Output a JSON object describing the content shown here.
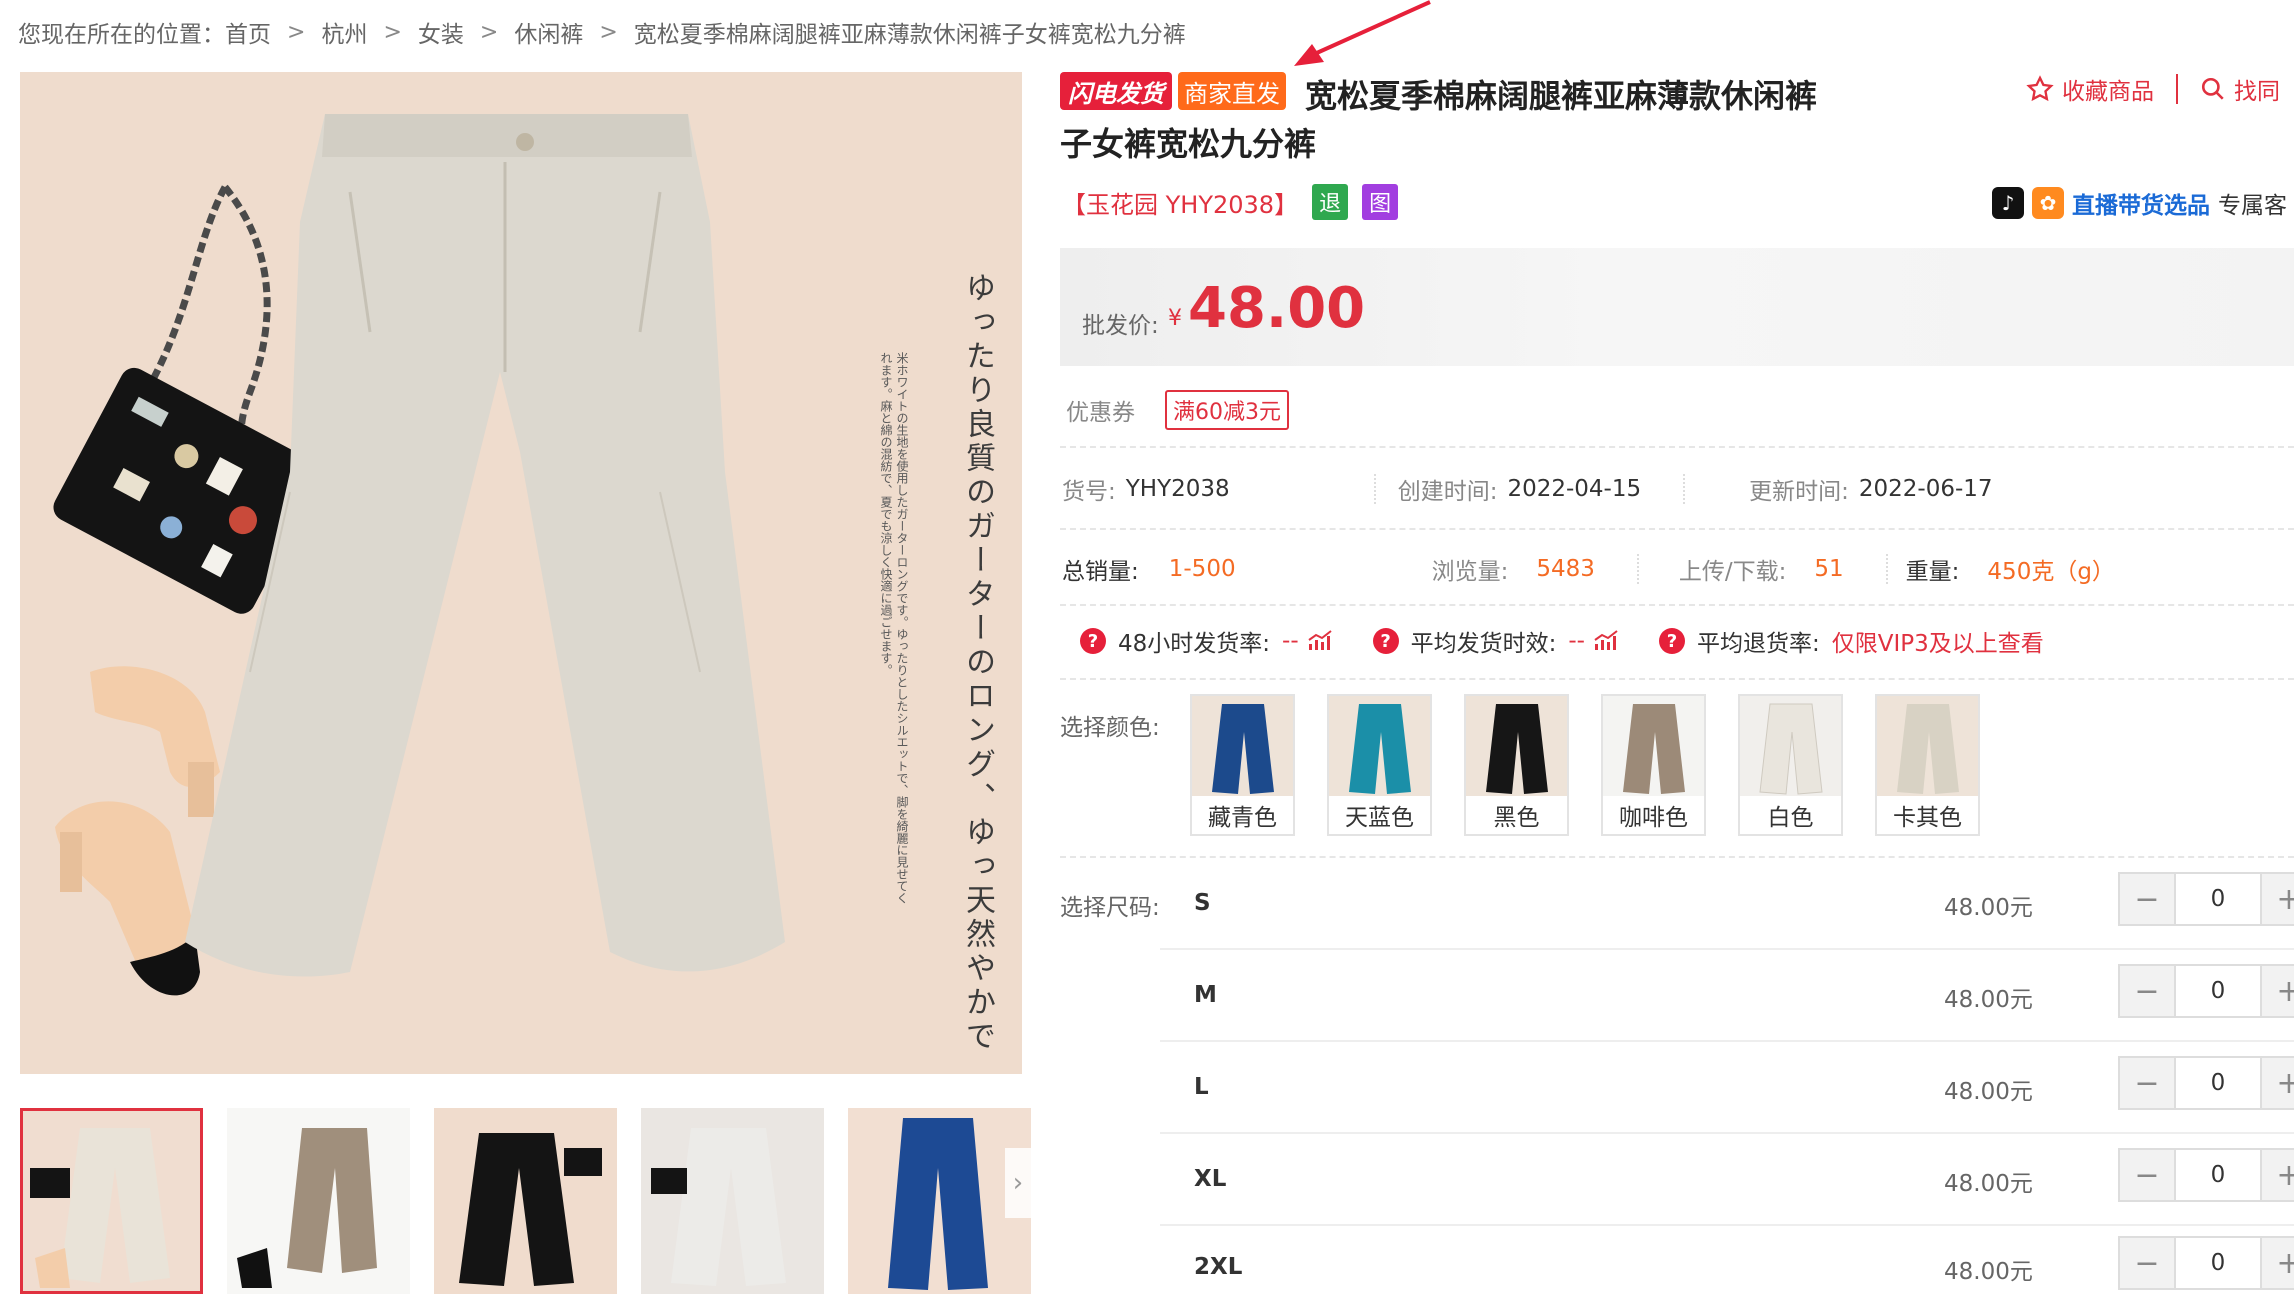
{
  "breadcrumb": {
    "prefix": "您现在所在的位置：",
    "items": [
      "首页",
      "杭州",
      "女装",
      "休闲裤",
      "宽松夏季棉麻阔腿裤亚麻薄款休闲裤子女裤宽松九分裤"
    ]
  },
  "product": {
    "badges": {
      "flash": "闪电发货",
      "direct": "商家直发"
    },
    "title": "宽松夏季棉麻阔腿裤亚麻薄款休闲裤子女裤宽松九分裤",
    "shop_code": "【玉花园 YHY2038】",
    "tags": {
      "return": "退",
      "image": "图"
    }
  },
  "actions": {
    "favorite": "收藏商品",
    "find_similar": "找同"
  },
  "live": {
    "text": "直播带货选品",
    "tail": "专属客"
  },
  "price": {
    "label": "批发价:",
    "currency": "¥",
    "value": "48.00"
  },
  "coupon": {
    "label": "优惠券",
    "tag": "满60减3元"
  },
  "info": {
    "item_no_label": "货号:",
    "item_no": "YHY2038",
    "created_label": "创建时间:",
    "created": "2022-04-15",
    "updated_label": "更新时间:",
    "updated": "2022-06-17",
    "sales_label": "总销量:",
    "sales": "1-500",
    "views_label": "浏览量:",
    "views": "5483",
    "uploads_label": "上传/下载:",
    "uploads": "51",
    "weight_label": "重量:",
    "weight": "450克（g）"
  },
  "shipping": {
    "rate48_label": "48小时发货率:",
    "rate48": "--",
    "avg_time_label": "平均发货时效:",
    "avg_time": "--",
    "return_rate_label": "平均退货率:",
    "return_rate": "仅限VIP3及以上查看"
  },
  "colors": {
    "label": "选择颜色:",
    "options": [
      {
        "name": "藏青色",
        "color": "#1c4a8c"
      },
      {
        "name": "天蓝色",
        "color": "#1b8fa8"
      },
      {
        "name": "黑色",
        "color": "#161616"
      },
      {
        "name": "咖啡色",
        "color": "#9c8a78"
      },
      {
        "name": "白色",
        "color": "#e9e5dd"
      },
      {
        "name": "卡其色",
        "color": "#d8d2c4"
      }
    ]
  },
  "sizes": {
    "label": "选择尺码:",
    "rows": [
      {
        "size": "S",
        "price": "48.00元",
        "qty": "0"
      },
      {
        "size": "M",
        "price": "48.00元",
        "qty": "0"
      },
      {
        "size": "L",
        "price": "48.00元",
        "qty": "0"
      },
      {
        "size": "XL",
        "price": "48.00元",
        "qty": "0"
      },
      {
        "size": "2XL",
        "price": "48.00元",
        "qty": "0"
      }
    ]
  },
  "image_text": {
    "vertical": "ゆったり良質のガーターのロング、ゆっ天然やかで",
    "small": "米ホワイトの生地を使用したガーターロングです。ゆったりとしたシルエットで、脚を綺麗に見せてくれます。麻と綿の混紡で、夏でも涼しく快適に過ごせます。"
  },
  "thumbnail_colors": [
    "#e9e3d8",
    "#a08f7c",
    "#141414",
    "#ecebe8",
    "#1d4a94"
  ]
}
